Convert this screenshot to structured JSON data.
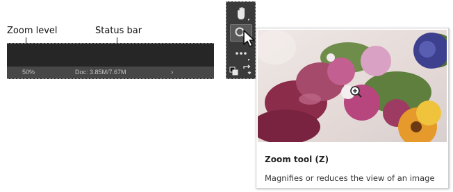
{
  "callouts": {
    "zoom_level_label": "Zoom level",
    "status_bar_label": "Status bar"
  },
  "status_bar": {
    "zoom_value": "50%",
    "doc_info": "Doc: 3.85M/7.67M",
    "expand_arrow": "›"
  },
  "tools": [
    {
      "icon": "hand-icon"
    },
    {
      "icon": "zoom-icon",
      "selected": true
    },
    {
      "icon": "more-tools-icon"
    },
    {
      "icon": "default-colors-icon"
    },
    {
      "icon": "swap-colors-icon"
    }
  ],
  "tooltip": {
    "title": "Zoom tool (Z)",
    "description": "Magnifies or reduces the view of an image"
  },
  "colors": {
    "status_bg": "#474747",
    "panel_dark": "#262626",
    "toolbar_bg": "#3a3a3a"
  }
}
